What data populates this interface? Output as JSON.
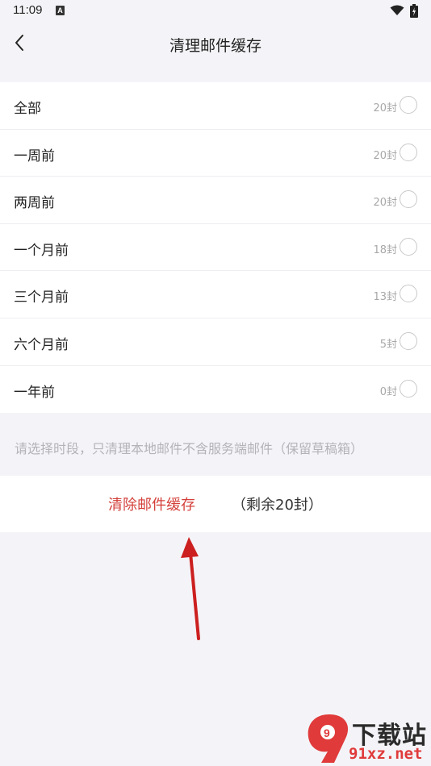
{
  "status_bar": {
    "time": "11:09",
    "notif_icon": "A"
  },
  "header": {
    "title": "清理邮件缓存",
    "back_icon": "chevron-left-icon"
  },
  "options": [
    {
      "label": "全部",
      "count": "20封"
    },
    {
      "label": "一周前",
      "count": "20封"
    },
    {
      "label": "两周前",
      "count": "20封"
    },
    {
      "label": "一个月前",
      "count": "18封"
    },
    {
      "label": "三个月前",
      "count": "13封"
    },
    {
      "label": "六个月前",
      "count": "5封"
    },
    {
      "label": "一年前",
      "count": "0封"
    }
  ],
  "hint": "请选择时段，只清理本地邮件不含服务端邮件（保留草稿箱）",
  "action": {
    "clear_label": "清除邮件缓存",
    "remaining": "（剩余20封）"
  },
  "watermark": {
    "brand": "下载站",
    "logo": "9",
    "url": "91xz.net"
  },
  "colors": {
    "accent": "#d43f3a",
    "annotation_arrow": "#cc1f1f"
  }
}
